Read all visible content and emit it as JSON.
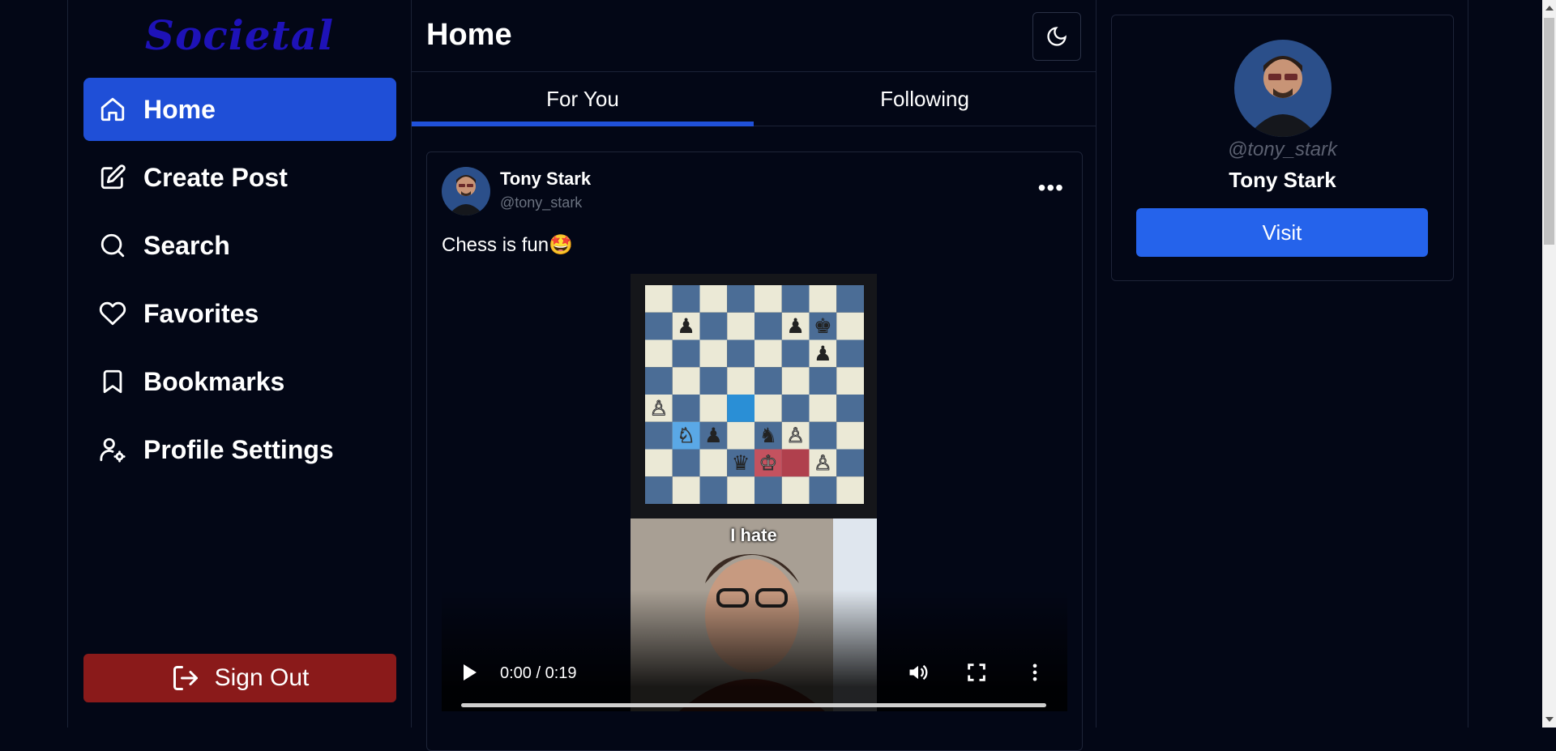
{
  "brand": {
    "logo": "Societal"
  },
  "sidebar": {
    "items": [
      {
        "label": "Home",
        "icon": "home-icon",
        "active": true
      },
      {
        "label": "Create Post",
        "icon": "edit-icon"
      },
      {
        "label": "Search",
        "icon": "search-icon"
      },
      {
        "label": "Favorites",
        "icon": "heart-icon"
      },
      {
        "label": "Bookmarks",
        "icon": "bookmark-icon"
      },
      {
        "label": "Profile Settings",
        "icon": "user-gear-icon"
      }
    ],
    "sign_out": "Sign Out"
  },
  "header": {
    "title": "Home",
    "theme_icon": "moon-icon"
  },
  "tabs": [
    {
      "label": "For You",
      "active": true
    },
    {
      "label": "Following"
    }
  ],
  "post": {
    "author_name": "Tony Stark",
    "author_handle": "@tony_stark",
    "text": "Chess is fun🤩",
    "video": {
      "caption": "I hate",
      "time": "0:00 / 0:19"
    }
  },
  "profile_card": {
    "handle": "@tony_stark",
    "name": "Tony Stark",
    "visit_label": "Visit"
  },
  "colors": {
    "background": "#030716",
    "accent": "#1f4fd7",
    "danger": "#8a1a1a",
    "logo": "#1e12b8"
  }
}
